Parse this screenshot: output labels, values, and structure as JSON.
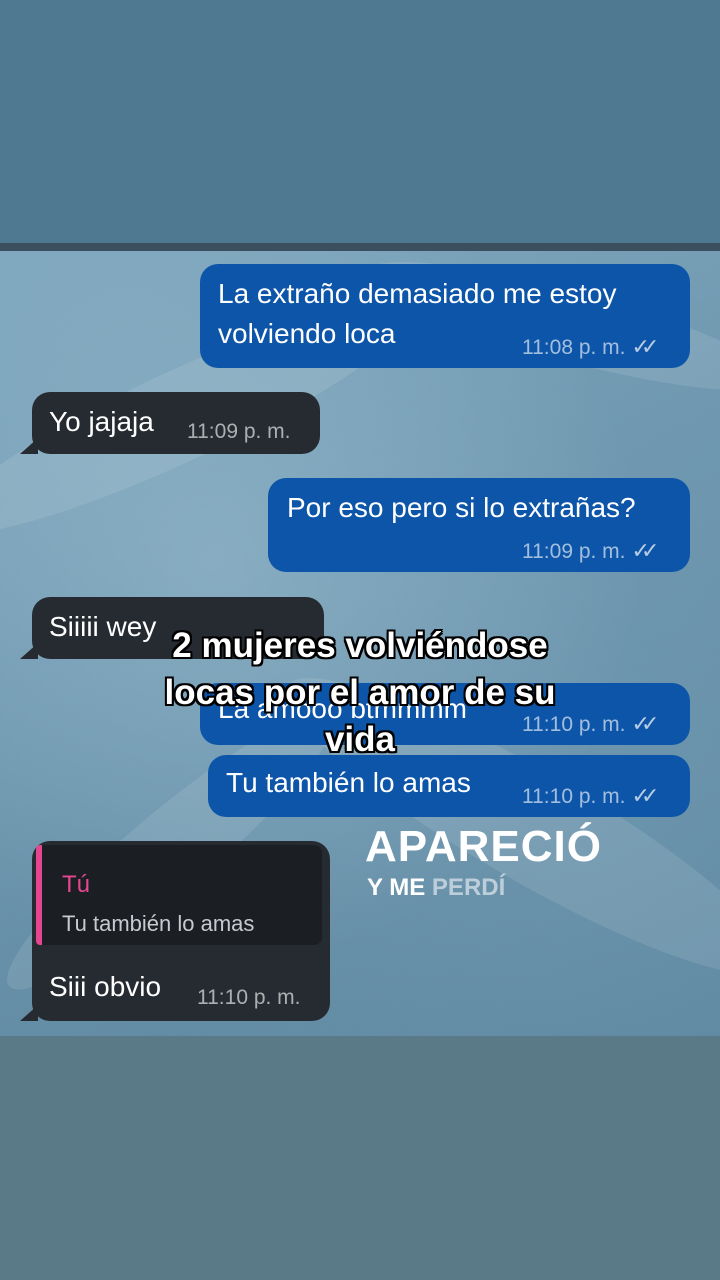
{
  "messages": [
    {
      "text_line1": "La extraño demasiado me estoy",
      "text_line2": "volviendo loca",
      "time": "11:08 p. m.",
      "ticks": "✓✓"
    },
    {
      "text": "Yo jajaja",
      "time": "11:09 p. m."
    },
    {
      "text": "Por eso pero si lo extrañas?",
      "time": "11:09 p. m.",
      "ticks": "✓✓"
    },
    {
      "text": "Siiiii wey"
    },
    {
      "text": "La amooo btmmmm",
      "time": "11:10 p. m.",
      "ticks": "✓✓"
    },
    {
      "text": "Tu también lo amas",
      "time": "11:10 p. m.",
      "ticks": "✓✓"
    },
    {
      "reply_name": "Tú",
      "reply_text": "Tu también lo amas",
      "text": "Siii obvio",
      "time": "11:10 p. m."
    }
  ],
  "caption": {
    "line1": "2 mujeres volviéndose",
    "line2": "locas por el amor de su",
    "line3": "vida"
  },
  "sticker": {
    "line1": "APARECIÓ",
    "line2a": "Y ME ",
    "line2b": "PERDÍ"
  },
  "colors": {
    "outgoing": "#0d55a8",
    "incoming": "#262b31",
    "reply_accent": "#e5468f"
  }
}
